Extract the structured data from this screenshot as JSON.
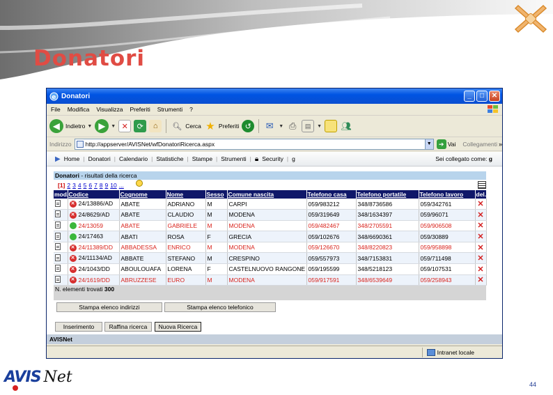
{
  "slide": {
    "title": "Donatori",
    "page_number": "44",
    "brand_avis": "AVIS",
    "brand_net": "Net"
  },
  "window": {
    "title": "Donatori",
    "menu": [
      "File",
      "Modifica",
      "Visualizza",
      "Preferiti",
      "Strumenti",
      "?"
    ],
    "toolbar": {
      "back_label": "Indietro",
      "search_label": "Cerca",
      "favorites_label": "Preferiti"
    },
    "address": {
      "label": "Indirizzo",
      "url": "http://appserver/AVISNet/wfDonatoriRicerca.aspx",
      "go_label": "Vai",
      "links_label": "Collegamenti"
    },
    "status": {
      "zone": "Intranet locale"
    }
  },
  "app": {
    "nav": [
      "Home",
      "Donatori",
      "Calendario",
      "Statistiche",
      "Stampe",
      "Strumenti"
    ],
    "security_label": "Security",
    "nav_extra": "g",
    "logged_in_label": "Sei collegato come:",
    "logged_in_user": "g",
    "footer_brand": "AVISNet",
    "panel": {
      "title_bold": "Donatori",
      "title_rest": " - risultati della ricerca"
    },
    "pager": {
      "current": "[1]",
      "pages": [
        "2",
        "3",
        "4",
        "5",
        "6",
        "7",
        "8",
        "9",
        "10",
        "..."
      ]
    },
    "columns": [
      "mod.",
      "Codice",
      "Cognome",
      "Nome",
      "Sesso",
      "Comune nascita",
      "Telefono casa",
      "Telefono portatile",
      "Telefono lavoro",
      "del."
    ],
    "rows": [
      {
        "status": "red",
        "codice": "24/13886/AD",
        "cognome": "ABATE",
        "nome": "ADRIANO",
        "sesso": "M",
        "comune": "CARPI",
        "tel_casa": "059/983212",
        "tel_port": "348/8736586",
        "tel_lav": "059/342761",
        "highlight": false
      },
      {
        "status": "red",
        "codice": "24/8629/AD",
        "cognome": "ABATE",
        "nome": "CLAUDIO",
        "sesso": "M",
        "comune": "MODENA",
        "tel_casa": "059/319649",
        "tel_port": "348/1634397",
        "tel_lav": "059/96071",
        "highlight": false
      },
      {
        "status": "green",
        "codice": "24/13059",
        "cognome": "ABATE",
        "nome": "GABRIELE",
        "sesso": "M",
        "comune": "MODENA",
        "tel_casa": "059/482467",
        "tel_port": "348/2705591",
        "tel_lav": "059/906508",
        "highlight": true
      },
      {
        "status": "green",
        "codice": "24/17463",
        "cognome": "ABATI",
        "nome": "ROSA",
        "sesso": "F",
        "comune": "GRECIA",
        "tel_casa": "059/102676",
        "tel_port": "348/6690361",
        "tel_lav": "059/30889",
        "highlight": false
      },
      {
        "status": "red",
        "codice": "24/11389/DD",
        "cognome": "ABBADESSA",
        "nome": "ENRICO",
        "sesso": "M",
        "comune": "MODENA",
        "tel_casa": "059/126670",
        "tel_port": "348/8220823",
        "tel_lav": "059/958898",
        "highlight": true
      },
      {
        "status": "red",
        "codice": "24/11134/AD",
        "cognome": "ABBATE",
        "nome": "STEFANO",
        "sesso": "M",
        "comune": "CRESPINO",
        "tel_casa": "059/557973",
        "tel_port": "348/7153831",
        "tel_lav": "059/711498",
        "highlight": false
      },
      {
        "status": "red",
        "codice": "24/1043/DD",
        "cognome": "ABOULOUAFA",
        "nome": "LORENA",
        "sesso": "F",
        "comune": "CASTELNUOVO RANGONE",
        "tel_casa": "059/195599",
        "tel_port": "348/5218123",
        "tel_lav": "059/107531",
        "highlight": false
      },
      {
        "status": "red",
        "codice": "24/1619/DD",
        "cognome": "ABRUZZESE",
        "nome": "EURO",
        "sesso": "M",
        "comune": "MODENA",
        "tel_casa": "059/917591",
        "tel_port": "348/6539649",
        "tel_lav": "059/258943",
        "highlight": true
      }
    ],
    "count_label": "N. elementi trovati",
    "count_value": "300",
    "buttons": {
      "print_addresses": "Stampa elenco indirizzi",
      "print_phones": "Stampa elenco telefonico",
      "insert": "Inserimento",
      "refine": "Raffina ricerca",
      "new_search": "Nuova Ricerca"
    }
  }
}
